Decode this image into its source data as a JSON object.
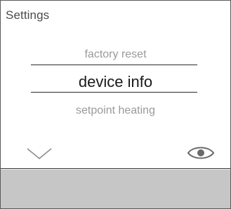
{
  "screen": {
    "title": "Settings"
  },
  "menu": {
    "previous_item": "factory reset",
    "selected_item": "device info",
    "next_item": "setpoint heating"
  },
  "icons": {
    "down": "chevron-down-icon",
    "view": "eye-icon"
  },
  "colors": {
    "screen_background": "#ffffff",
    "bottom_panel": "#c6c6c6",
    "selected_text": "#1a1a1a",
    "dimmed_text": "#9a9a9a"
  }
}
